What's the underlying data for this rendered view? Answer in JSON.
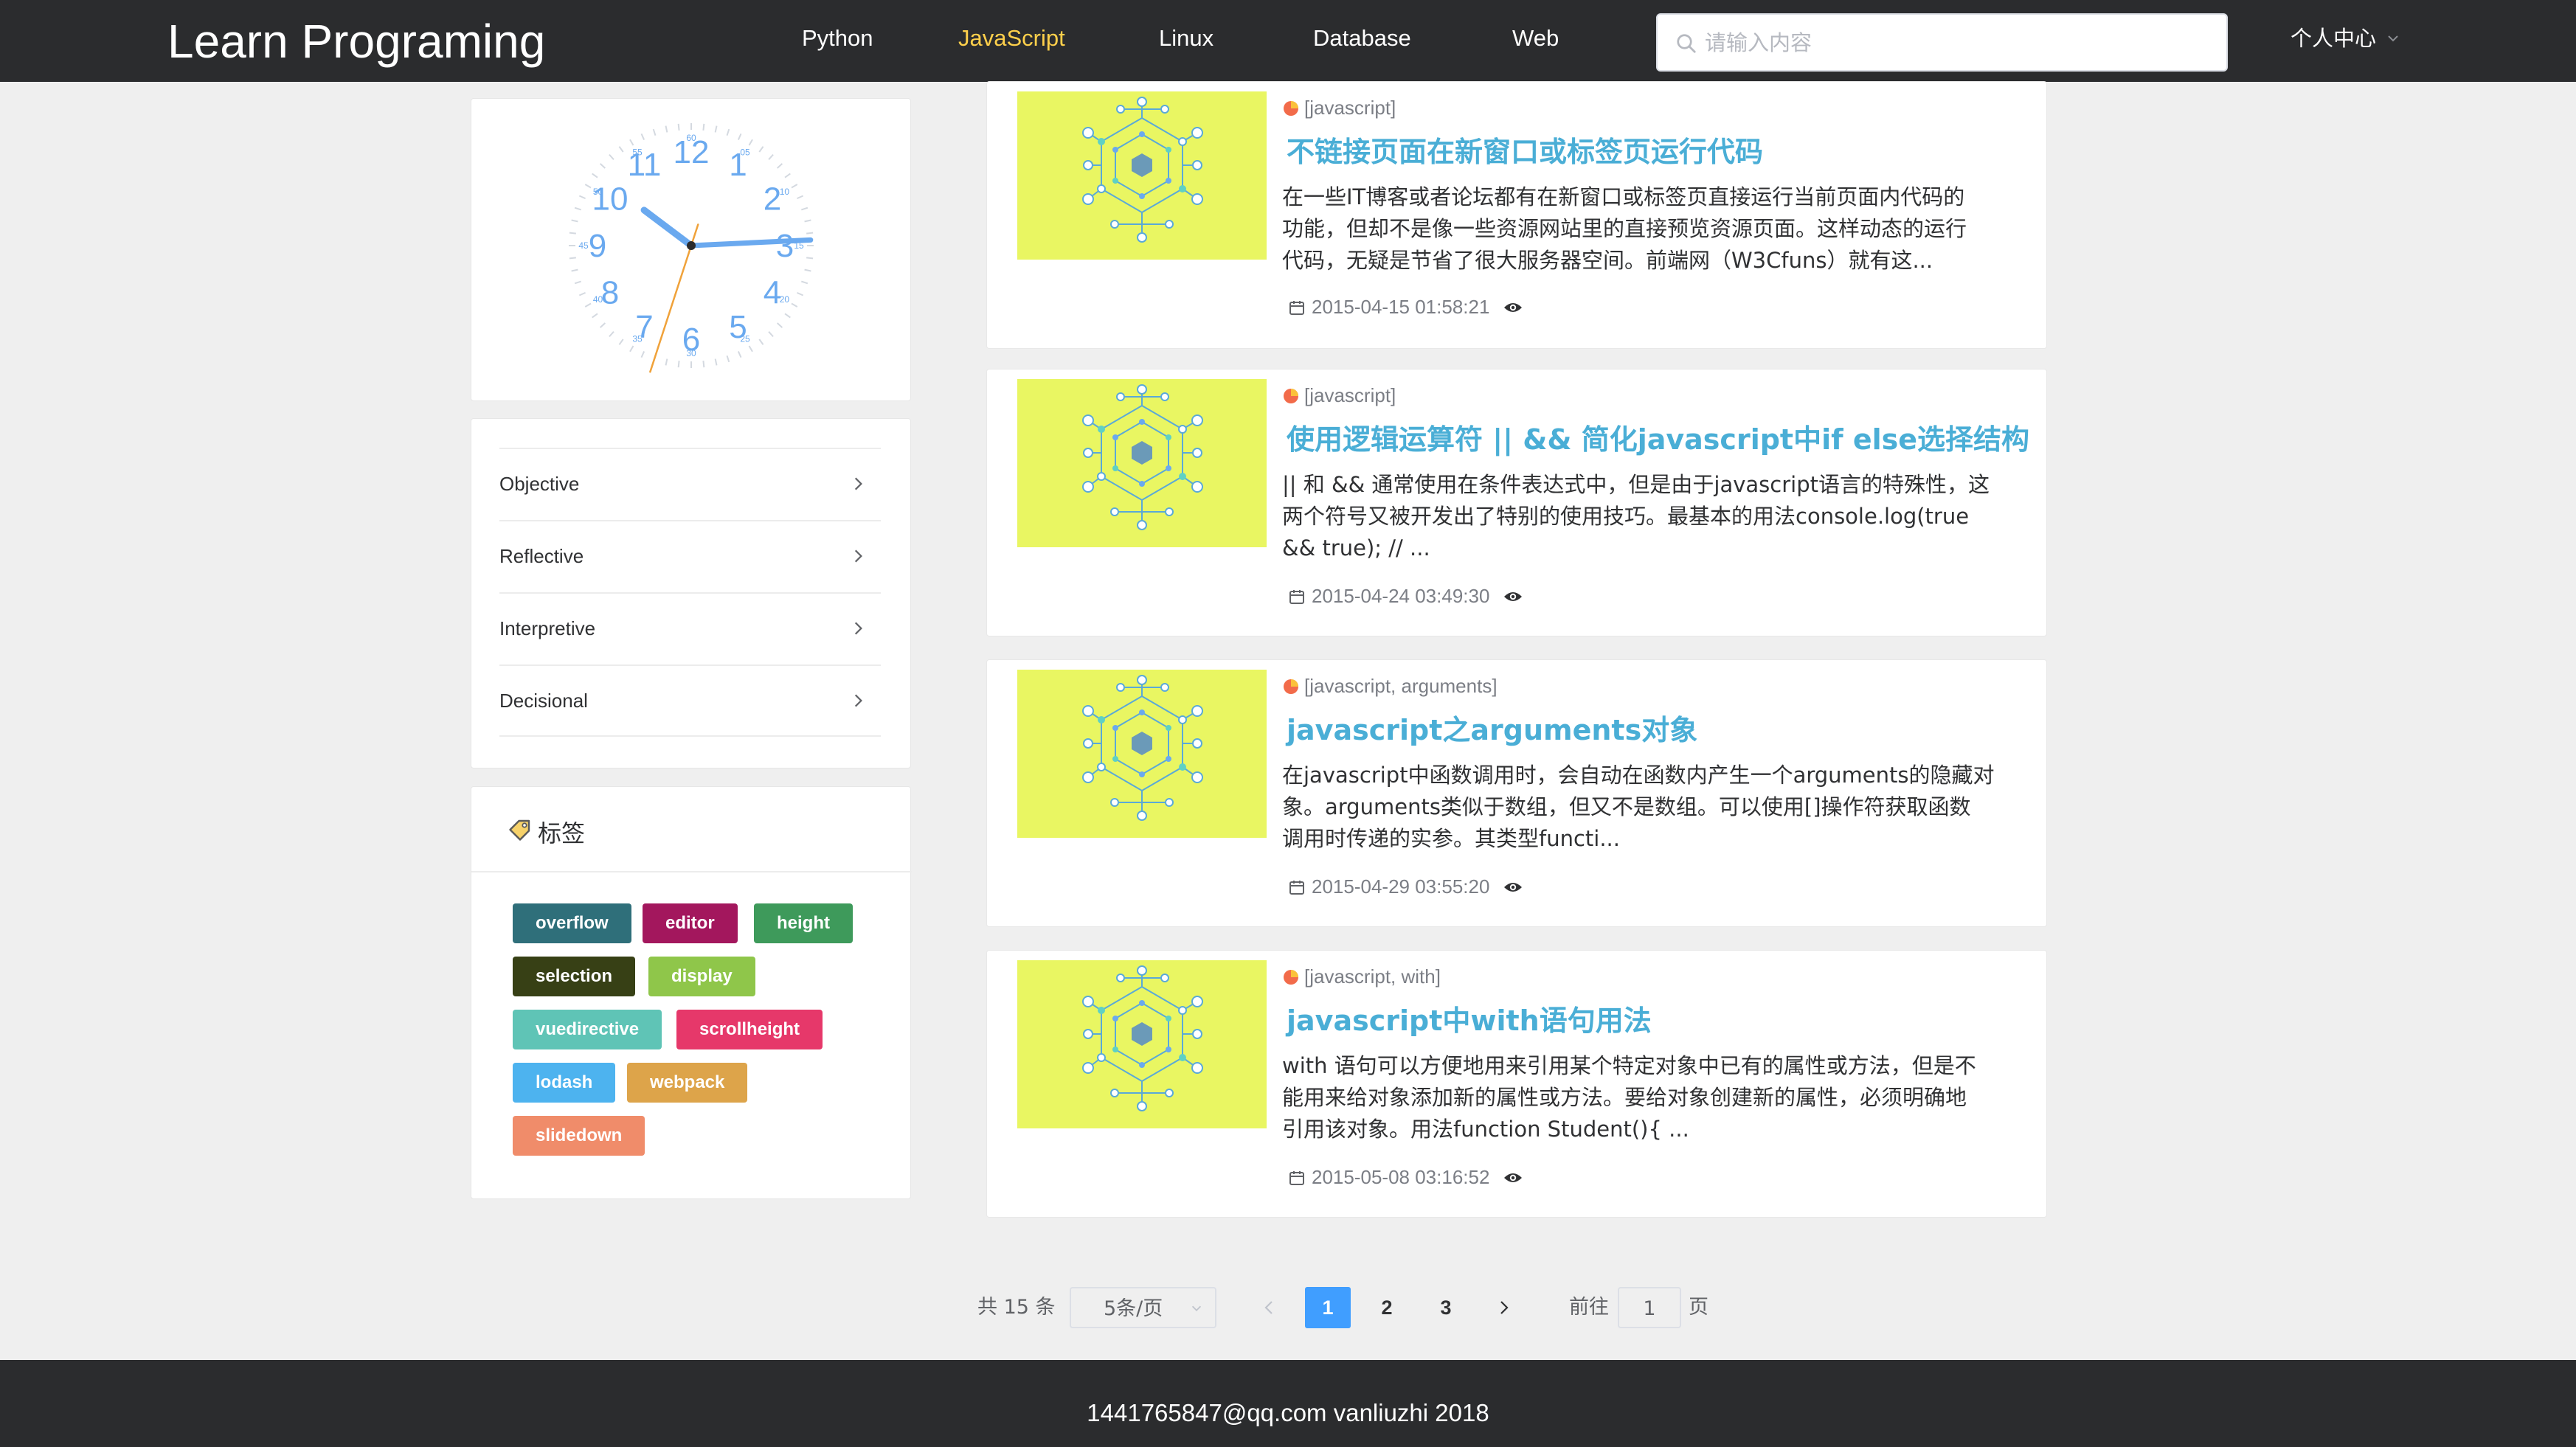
{
  "header": {
    "logo": "Learn Programing",
    "nav": [
      "Python",
      "JavaScript",
      "Linux",
      "Database",
      "Web"
    ],
    "active_nav": "JavaScript",
    "search_placeholder": "请输入内容",
    "user_menu": "个人中心"
  },
  "clock": {
    "numbers": [
      "12",
      "1",
      "2",
      "3",
      "4",
      "5",
      "6",
      "7",
      "8",
      "9",
      "10",
      "11"
    ],
    "minute_labels": [
      "60",
      "05",
      "10",
      "15",
      "20",
      "25",
      "30",
      "35",
      "40",
      "45",
      "50",
      "55"
    ],
    "time": {
      "hour": 10,
      "minute": 14,
      "second": 33
    }
  },
  "sidebar_menu": [
    "Objective",
    "Reflective",
    "Interpretive",
    "Decisional"
  ],
  "tags": {
    "title": "标签",
    "items": [
      {
        "label": "overflow",
        "color": "#2f6f7a"
      },
      {
        "label": "editor",
        "color": "#a3175d"
      },
      {
        "label": "height",
        "color": "#3e9a5b"
      },
      {
        "label": "selection",
        "color": "#374015"
      },
      {
        "label": "display",
        "color": "#8fc64a"
      },
      {
        "label": "vuedirective",
        "color": "#5fc4b6"
      },
      {
        "label": "scrollheight",
        "color": "#e6386a"
      },
      {
        "label": "lodash",
        "color": "#4db3ef"
      },
      {
        "label": "webpack",
        "color": "#dda44a"
      },
      {
        "label": "slidedown",
        "color": "#f08c6a"
      }
    ]
  },
  "articles": [
    {
      "category": "[javascript]",
      "title": "不链接页面在新窗口或标签页运行代码",
      "summary": [
        "在一些IT博客或者论坛都有在新窗口或标签页直接运行当前页面内代码的",
        "功能，但却不是像一些资源网站里的直接预览资源页面。这样动态的运行",
        "代码，无疑是节省了很大服务器空间。前端网（W3Cfuns）就有这..."
      ],
      "date": "2015-04-15 01:58:21"
    },
    {
      "category": "[javascript]",
      "title": "使用逻辑运算符 || && 简化javascript中if else选择结构",
      "summary": [
        "|| 和 && 通常使用在条件表达式中，但是由于javascript语言的特殊性，这",
        "两个符号又被开发出了特别的使用技巧。最基本的用法console.log(true",
        "&& true); // ..."
      ],
      "date": "2015-04-24 03:49:30"
    },
    {
      "category": "[javascript, arguments]",
      "title": "javascript之arguments对象",
      "summary": [
        "在javascript中函数调用时，会自动在函数内产生一个arguments的隐藏对",
        "象。arguments类似于数组，但又不是数组。可以使用[]操作符获取函数",
        "调用时传递的实参。其类型functi..."
      ],
      "date": "2015-04-29 03:55:20"
    },
    {
      "category": "[javascript, with]",
      "title": "javascript中with语句用法",
      "summary": [
        "with 语句可以方便地用来引用某个特定对象中已有的属性或方法，但是不",
        "能用来给对象添加新的属性或方法。要给对象创建新的属性，必须明确地",
        "引用该对象。用法function Student(){ ..."
      ],
      "date": "2015-05-08 03:16:52"
    }
  ],
  "pagination": {
    "total": "共 15 条",
    "page_size": "5条/页",
    "pages": [
      "1",
      "2",
      "3"
    ],
    "current": "1",
    "goto_prefix": "前往",
    "goto_value": "1",
    "goto_suffix": "页"
  },
  "footer": "1441765847@qq.com vanliuzhi 2018"
}
